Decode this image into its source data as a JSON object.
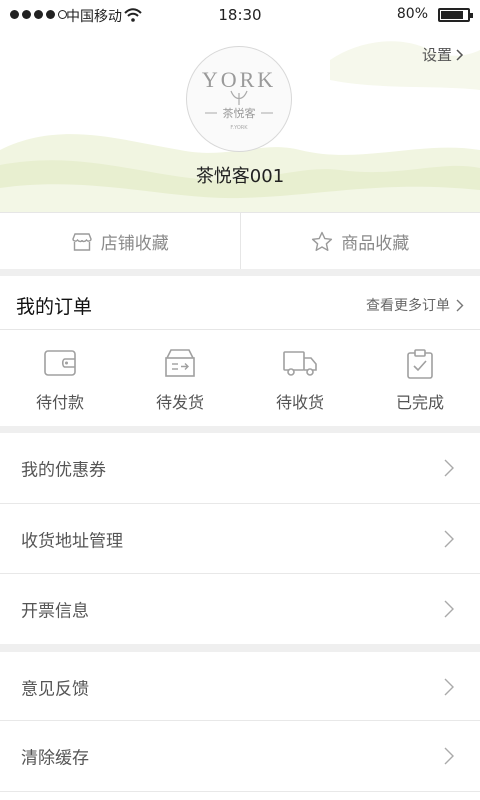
{
  "status_bar": {
    "carrier": "中国移动",
    "time": "18:30",
    "battery": "80%",
    "battery_level": 0.8
  },
  "profile": {
    "settings_label": "设置",
    "username": "茶悦客001",
    "logo": {
      "brand": "YORK",
      "cn": "茶悦客",
      "sub": "F.YORK"
    }
  },
  "favorites": [
    {
      "label": "店铺收藏",
      "icon": "shop-icon"
    },
    {
      "label": "商品收藏",
      "icon": "star-icon"
    }
  ],
  "orders": {
    "title": "我的订单",
    "more": "查看更多订单",
    "items": [
      {
        "label": "待付款",
        "icon": "wallet-icon"
      },
      {
        "label": "待发货",
        "icon": "box-ship-icon"
      },
      {
        "label": "待收货",
        "icon": "truck-icon"
      },
      {
        "label": "已完成",
        "icon": "clipboard-check-icon"
      }
    ]
  },
  "menu_group1": [
    {
      "label": "我的优惠券"
    },
    {
      "label": "收货地址管理"
    },
    {
      "label": "开票信息"
    }
  ],
  "menu_group2": [
    {
      "label": "意见反馈"
    },
    {
      "label": "清除缓存"
    }
  ],
  "colors": {
    "hill_green": "#e9f0cf",
    "divider_gray": "#efefef",
    "icon_gray": "#9a9a9a"
  }
}
